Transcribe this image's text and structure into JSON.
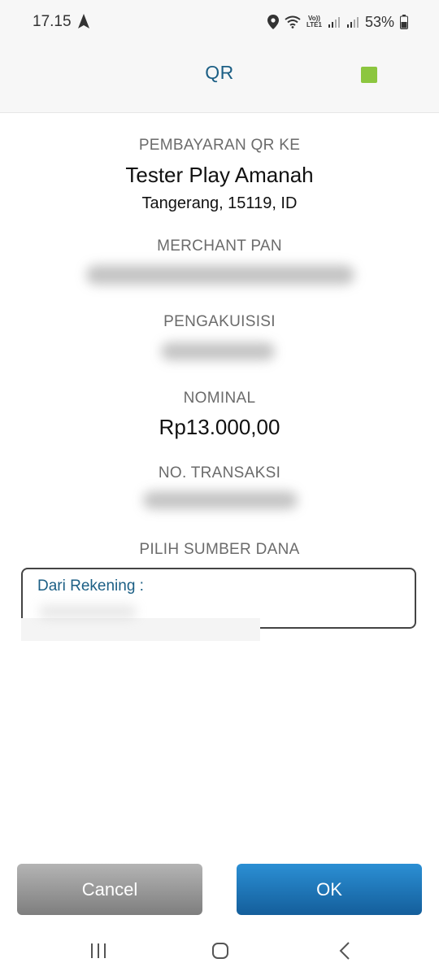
{
  "status_bar": {
    "time": "17.15",
    "battery": "53%",
    "lte_top": "Vo))",
    "lte_bottom": "LTE1",
    "icons": [
      "navigation-arrow-icon",
      "location-pin-icon",
      "wifi-icon",
      "signal-icon",
      "signal-icon",
      "battery-icon"
    ]
  },
  "header": {
    "title": "QR",
    "accent_square_color": "#8cc63f"
  },
  "payment": {
    "to_label": "PEMBAYARAN QR KE",
    "merchant_name": "Tester Play Amanah",
    "merchant_location": "Tangerang, 15119, ID",
    "pan_label": "MERCHANT PAN",
    "acquirer_label": "PENGAKUISISI",
    "amount_label": "NOMINAL",
    "amount": "Rp13.000,00",
    "trx_label": "NO. TRANSAKSI",
    "source_label": "PILIH SUMBER DANA"
  },
  "source_field": {
    "label": "Dari Rekening :"
  },
  "buttons": {
    "cancel": "Cancel",
    "ok": "OK"
  },
  "colors": {
    "title": "#1c5f85",
    "ok_button": "#1f75b8",
    "cancel_button": "#999999"
  }
}
